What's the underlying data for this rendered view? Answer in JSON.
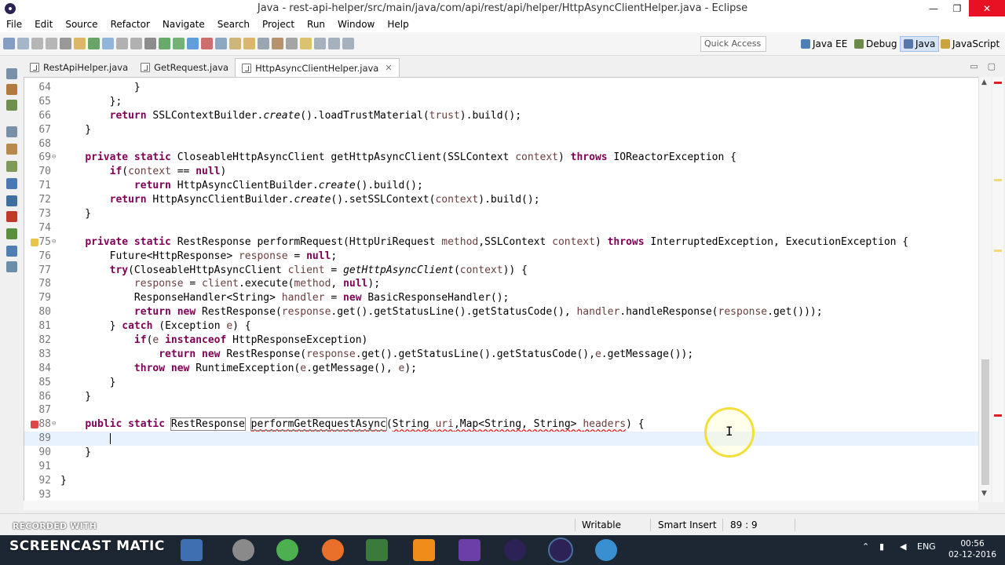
{
  "window": {
    "title": "Java - rest-api-helper/src/main/java/com/api/rest/api/helper/HttpAsyncClientHelper.java - Eclipse",
    "controls": [
      "—",
      "❐",
      "✕"
    ]
  },
  "menu": [
    "File",
    "Edit",
    "Source",
    "Refactor",
    "Navigate",
    "Search",
    "Project",
    "Run",
    "Window",
    "Help"
  ],
  "toolbar": {
    "quick_access": "Quick Access",
    "perspectives": [
      "Java EE",
      "Debug",
      "Java",
      "JavaScript"
    ],
    "active_perspective": "Java"
  },
  "tabs": [
    {
      "label": "RestApiHelper.java",
      "active": false
    },
    {
      "label": "GetRequest.java",
      "active": false
    },
    {
      "label": "HttpAsyncClientHelper.java",
      "active": true
    }
  ],
  "editor": {
    "lines": [
      {
        "n": "64",
        "html": "            }"
      },
      {
        "n": "65",
        "html": "        };"
      },
      {
        "n": "66",
        "html": "        <span class=\"kw\">return</span> SSLContextBuilder.<span class=\"it\">create</span>().loadTrustMaterial(<span class=\"var\">trust</span>).build();"
      },
      {
        "n": "67",
        "html": "    }"
      },
      {
        "n": "68",
        "html": ""
      },
      {
        "n": "69",
        "fold": "⊖",
        "html": "    <span class=\"kw\">private static</span> CloseableHttpAsyncClient getHttpAsyncClient(SSLContext <span class=\"var\">context</span>) <span class=\"kw\">throws</span> IOReactorException {"
      },
      {
        "n": "70",
        "html": "        <span class=\"kw\">if</span>(<span class=\"var\">context</span> == <span class=\"kw\">null</span>)"
      },
      {
        "n": "71",
        "html": "            <span class=\"kw\">return</span> HttpAsyncClientBuilder.<span class=\"it\">create</span>().build();"
      },
      {
        "n": "72",
        "html": "        <span class=\"kw\">return</span> HttpAsyncClientBuilder.<span class=\"it\">create</span>().setSSLContext(<span class=\"var\">context</span>).build();"
      },
      {
        "n": "73",
        "html": "    }"
      },
      {
        "n": "74",
        "html": ""
      },
      {
        "n": "75",
        "fold": "⊖",
        "marker": "warning",
        "html": "    <span class=\"kw\">private static</span> RestResponse performRequest(HttpUriRequest <span class=\"var\">method</span>,SSLContext <span class=\"var\">context</span>) <span class=\"kw\">throws</span> InterruptedException, ExecutionException {"
      },
      {
        "n": "76",
        "html": "        Future&lt;HttpResponse&gt; <span class=\"var\">response</span> = <span class=\"kw\">null</span>;"
      },
      {
        "n": "77",
        "html": "        <span class=\"kw\">try</span>(CloseableHttpAsyncClient <span class=\"var\">client</span> = <span class=\"it\">getHttpAsyncClient</span>(<span class=\"var\">context</span>)) {"
      },
      {
        "n": "78",
        "html": "            <span class=\"var\">response</span> = <span class=\"var\">client</span>.execute(<span class=\"var\">method</span>, <span class=\"kw\">null</span>);"
      },
      {
        "n": "79",
        "html": "            ResponseHandler&lt;String&gt; <span class=\"var\">handler</span> = <span class=\"kw\">new</span> BasicResponseHandler();"
      },
      {
        "n": "80",
        "html": "            <span class=\"kw\">return new</span> RestResponse(<span class=\"var\">response</span>.get().getStatusLine().getStatusCode(), <span class=\"var\">handler</span>.handleResponse(<span class=\"var\">response</span>.get()));"
      },
      {
        "n": "81",
        "html": "        } <span class=\"kw\">catch</span> (Exception <span class=\"var\">e</span>) {"
      },
      {
        "n": "82",
        "html": "            <span class=\"kw\">if</span>(<span class=\"var\">e</span> <span class=\"kw\">instanceof</span> HttpResponseException)"
      },
      {
        "n": "83",
        "html": "                <span class=\"kw\">return new</span> RestResponse(<span class=\"var\">response</span>.get().getStatusLine().getStatusCode(),<span class=\"var\">e</span>.getMessage());"
      },
      {
        "n": "84",
        "html": "            <span class=\"kw\">throw new</span> RuntimeException(<span class=\"var\">e</span>.getMessage(), <span class=\"var\">e</span>);"
      },
      {
        "n": "85",
        "html": "        }"
      },
      {
        "n": "86",
        "html": "    }"
      },
      {
        "n": "87",
        "html": ""
      },
      {
        "n": "88",
        "fold": "⊖",
        "marker": "error",
        "html": "    <span class=\"kw\">public static</span> <span class=\"box\">RestResponse</span> <span class=\"box err\">performGetRequestAsync</span>(<span class=\"err\">String <span class=\"var\">uri</span>,Map&lt;String, String&gt; <span class=\"var\">headers</span></span>) {"
      },
      {
        "n": "89",
        "current": true,
        "caret": true,
        "html": "        "
      },
      {
        "n": "90",
        "html": "    }"
      },
      {
        "n": "91",
        "html": ""
      },
      {
        "n": "92",
        "html": "}"
      },
      {
        "n": "93",
        "html": ""
      }
    ]
  },
  "statusbar": {
    "writable": "Writable",
    "insert_mode": "Smart Insert",
    "position": "89 : 9"
  },
  "watermark": {
    "recorded": "RECORDED WITH",
    "brand": "SCREENCAST",
    "brand2": "MATIC"
  },
  "taskbar": {
    "lang": "ENG",
    "time": "00:56",
    "date": "02-12-2016"
  }
}
